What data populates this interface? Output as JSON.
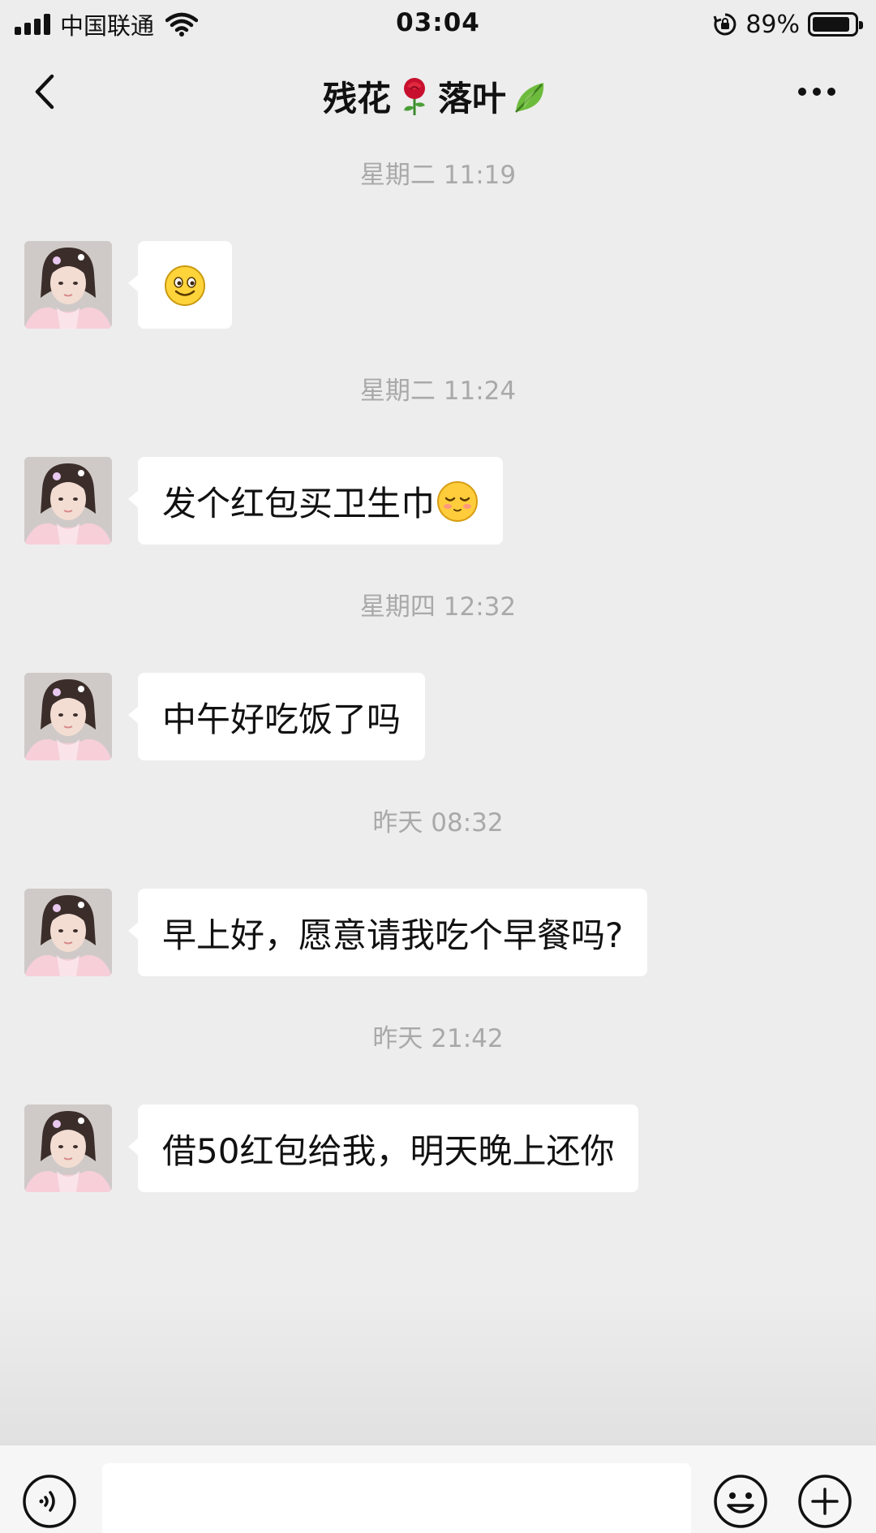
{
  "status_bar": {
    "carrier": "中国联通",
    "time": "03:04",
    "battery_percent": "89%",
    "battery_level": 0.89,
    "icons": [
      "signal-icon",
      "wifi-icon",
      "rotation-lock-icon",
      "battery-icon"
    ]
  },
  "nav": {
    "title_part1": "残花",
    "title_emoji1": "rose",
    "title_part2": "落叶",
    "title_emoji2": "leaf",
    "back_icon": "chevron-left-icon",
    "more_icon": "more-icon"
  },
  "messages": [
    {
      "timestamp": "星期二 11:19",
      "text": "",
      "emoji": "smile"
    },
    {
      "timestamp": "星期二 11:24",
      "text": "发个红包买卫生巾",
      "emoji": "shy"
    },
    {
      "timestamp": "星期四 12:32",
      "text": "中午好吃饭了吗",
      "emoji": ""
    },
    {
      "timestamp": "昨天 08:32",
      "text": "早上好，愿意请我吃个早餐吗?",
      "emoji": ""
    },
    {
      "timestamp": "昨天 21:42",
      "text": "借50红包给我，明天晚上还你",
      "emoji": ""
    }
  ],
  "input_bar": {
    "voice_icon": "voice-icon",
    "emoji_icon": "emoji-icon",
    "plus_icon": "plus-icon",
    "input_value": ""
  },
  "colors": {
    "background": "#ededed",
    "bubble": "#ffffff",
    "timestamp": "#a9a9a9"
  }
}
